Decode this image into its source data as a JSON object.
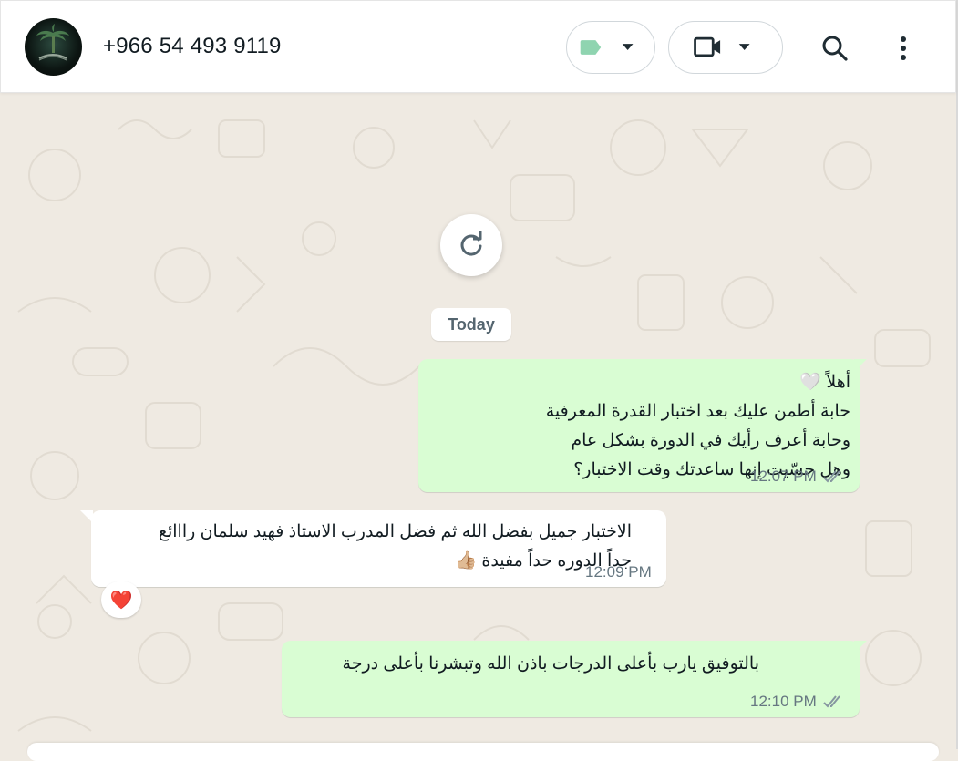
{
  "header": {
    "contact_name": "+966 54 493 9119",
    "avatar_icon": "profile-photo-palm-swords",
    "label_icon": "label-tag-icon",
    "video_icon": "video-camera-icon",
    "search_icon": "search-icon",
    "menu_icon": "more-vert-icon"
  },
  "chat": {
    "refresh_icon": "refresh-icon",
    "date_chip": "Today",
    "messages": [
      {
        "direction": "outgoing",
        "lines": [
          "أهلاً 🤍",
          "حابة أطمن عليك بعد اختبار القدرة المعرفية",
          "وحابة أعرف رأيك في الدورة بشكل عام",
          "وهل حسّيت إنها ساعدتك وقت الاختبار؟"
        ],
        "time": "12:07 PM",
        "status": "read-double-check"
      },
      {
        "direction": "incoming",
        "lines": [
          "الاختبار جميل بفضل الله ثم فضل المدرب الاستاذ فهيد سلمان رااائع",
          "جداً الدوره حداً مفيدة 👍🏼"
        ],
        "time": "12:09 PM",
        "reaction": "❤️"
      },
      {
        "direction": "outgoing",
        "lines": [
          "بالتوفيق يارب بأعلى الدرجات باذن الله وتبشرنا بأعلى درجة"
        ],
        "time": "12:10 PM",
        "status": "read-double-check"
      }
    ]
  },
  "colors": {
    "outgoing_bubble": "#d9fdd3",
    "incoming_bubble": "#ffffff",
    "chat_background": "#efeae2",
    "label_green": "#8fd4b0",
    "heart_red": "#e0242e"
  }
}
